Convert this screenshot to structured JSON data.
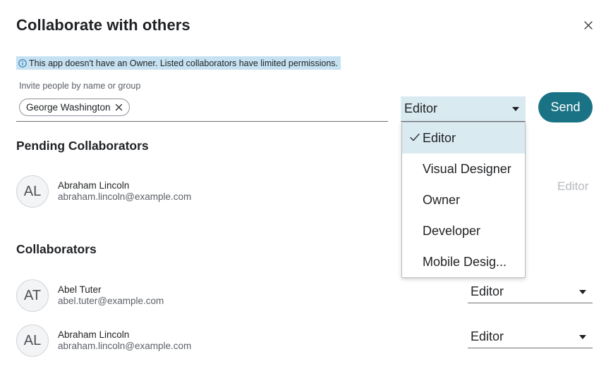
{
  "dialog": {
    "title": "Collaborate with others",
    "notice": "This app doesn't have an Owner. Listed collaborators have limited permissions.",
    "invite_label": "Invite people by name or group",
    "chip_label": "George Washington",
    "role_value": "Editor",
    "send_label": "Send"
  },
  "pending": {
    "heading": "Pending Collaborators",
    "people": [
      {
        "initials": "AL",
        "name": "Abraham Lincoln",
        "email": "abraham.lincoln@example.com",
        "role": "Editor"
      }
    ]
  },
  "collaborators": {
    "heading": "Collaborators",
    "people": [
      {
        "initials": "AT",
        "name": "Abel Tuter",
        "email": "abel.tuter@example.com",
        "role": "Editor"
      },
      {
        "initials": "AL",
        "name": "Abraham Lincoln",
        "email": "abraham.lincoln@example.com",
        "role": "Editor"
      }
    ]
  },
  "dropdown": {
    "options": [
      "Editor",
      "Visual Designer",
      "Owner",
      "Developer",
      "Mobile Desig..."
    ],
    "selected": "Editor"
  },
  "icons": {
    "close": "close-icon",
    "info": "info-icon",
    "chip_remove": "close-icon",
    "check": "check-icon",
    "caret": "chevron-down-icon"
  },
  "colors": {
    "primary": "#1a7385",
    "notice_bg": "#c6e2f2",
    "selected_bg": "#d9eaf1",
    "muted_text": "#b6b9bd"
  }
}
